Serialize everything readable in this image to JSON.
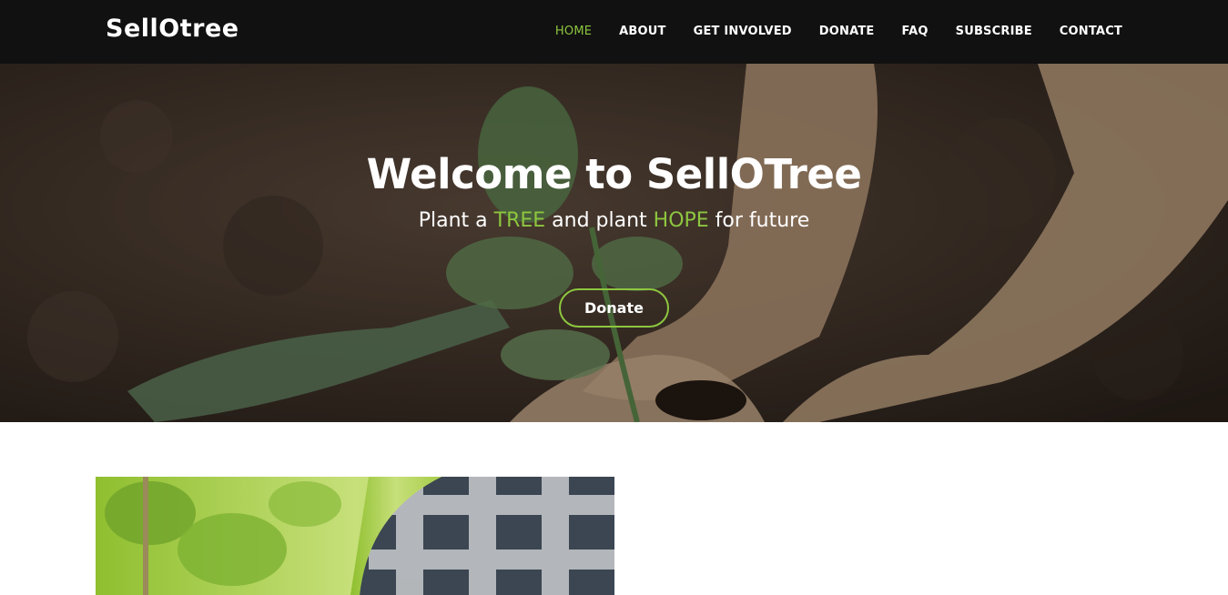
{
  "navbar": {
    "brand": "SellOtree",
    "links": [
      {
        "label": "HOME",
        "active": true
      },
      {
        "label": "ABOUT"
      },
      {
        "label": "GET INVOLVED"
      },
      {
        "label": "DONATE"
      },
      {
        "label": "FAQ"
      },
      {
        "label": "SUBSCRIBE"
      },
      {
        "label": "CONTACT"
      }
    ]
  },
  "hero": {
    "title": "Welcome to SellOTree",
    "subtitle_parts": [
      "Plant a ",
      "TREE",
      " and plant ",
      "HOPE",
      " for future"
    ],
    "button_label": "Donate",
    "background": "photo: hands planting a seedling in soil"
  },
  "content": {
    "image": "photo: person in plaid shirt planting a young tree"
  },
  "colors": {
    "accent": "#8dc63f",
    "navbar_bg": "#111111",
    "text_light": "#ffffff"
  }
}
